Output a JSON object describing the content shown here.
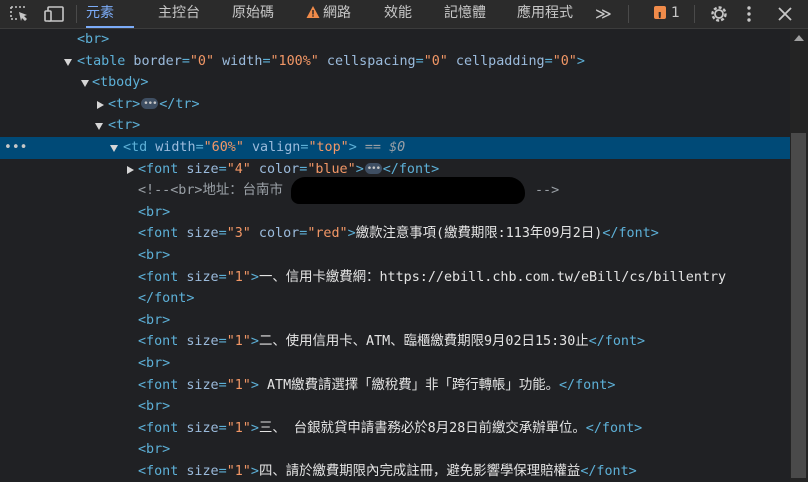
{
  "toolbar": {
    "tabs": [
      "元素",
      "主控台",
      "原始碼",
      "網路",
      "效能",
      "記憶體",
      "應用程式"
    ],
    "more_label": "≫",
    "issues_count": "1",
    "accent": "#7cacf8"
  },
  "icons": {
    "inspect": "inspect-element-icon",
    "device": "device-toolbar-icon",
    "warning": "warning-icon",
    "settings": "gear-icon",
    "menu": "kebab-menu-icon",
    "close": "close-icon"
  },
  "dom": {
    "l0": "<br>",
    "l1": {
      "open": "<table",
      "a1": " border",
      "v1": "\"0\"",
      "a2": " width",
      "v2": "\"100%\"",
      "a3": " cellspacing",
      "v3": "\"0\"",
      "a4": " cellpadding",
      "v4": "\"0\"",
      "close": ">"
    },
    "l2": "<tbody>",
    "l3": {
      "open": "<tr>",
      "close": "</tr>"
    },
    "l4": "<tr>",
    "l5": {
      "dots": "•••",
      "open": "<td",
      "a1": " width",
      "v1": "\"60%\"",
      "a2": " valign",
      "v2": "\"top\"",
      "close": ">",
      "eq": " == ",
      "dollar": "$0"
    },
    "l6": {
      "open": "<font",
      "a1": " size",
      "v1": "\"4\"",
      "a2": " color",
      "v2": "\"blue\"",
      "close": ">",
      "end": "</font>"
    },
    "l7": {
      "pre": "<!--<br>地址：台南市",
      "post": "-->"
    },
    "br": "<br>",
    "l9": {
      "open": "<font",
      "a1": " size",
      "v1": "\"3\"",
      "a2": " color",
      "v2": "\"red\"",
      "close": ">",
      "text": "繳款注意事項(繳費期限:113年09月2日)",
      "end": "</font>"
    },
    "l11": {
      "open": "<font",
      "a1": " size",
      "v1": "\"1\"",
      "close": ">",
      "text": "一、信用卡繳費網：https://ebill.chb.com.tw/eBill/cs/billentry"
    },
    "l12": "</font>",
    "l14": {
      "open": "<font",
      "a1": " size",
      "v1": "\"1\"",
      "close": ">",
      "text": "二、使用信用卡、ATM、臨櫃繳費期限9月02日15:30止",
      "end": "</font>"
    },
    "l16": {
      "open": "<font",
      "a1": " size",
      "v1": "\"1\"",
      "close": ">",
      "text": " ATM繳費請選擇「繳稅費」非「跨行轉帳」功能。",
      "end": "</font>"
    },
    "l18": {
      "open": "<font",
      "a1": " size",
      "v1": "\"1\"",
      "close": ">",
      "text": "三、  台銀就貸申請書務必於8月28日前繳交承辦單位。",
      "end": "</font>"
    },
    "l20": {
      "open": "<font",
      "a1": " size",
      "v1": "\"1\"",
      "close": ">",
      "text": "四、請於繳費期限內完成註冊，避免影響學保理賠權益",
      "end": "</font>"
    }
  }
}
